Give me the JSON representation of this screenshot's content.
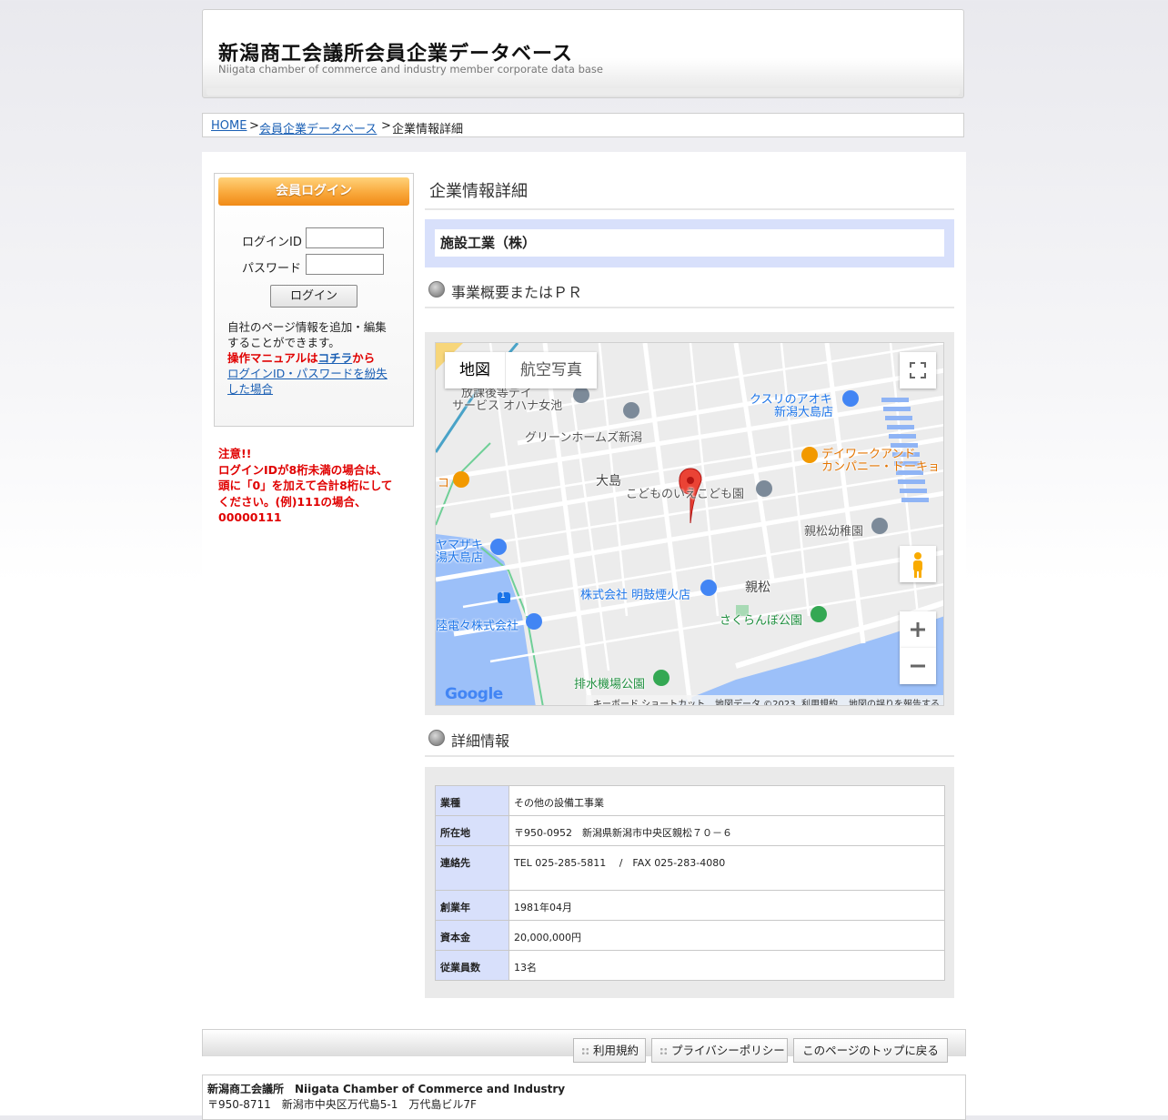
{
  "header": {
    "title": "新潟商工会議所会員企業データベース",
    "subtitle": "Niigata chamber of commerce and industry member corporate data base"
  },
  "breadcrumb": {
    "home": "HOME",
    "sep1": ">",
    "db": "会員企業データベース",
    "sep2": ">",
    "current": "企業情報詳細"
  },
  "sidebar": {
    "login_title": "会員ログイン",
    "login_id_label": "ログインID",
    "password_label": "パスワード",
    "login_id_value": "",
    "password_value": "",
    "login_button": "ログイン",
    "info_line1": "自社のページ情報を追加・編集",
    "info_line2": "することができます。",
    "manual_prefix": "操作マニュアルは",
    "manual_link": "コチラ",
    "manual_suffix": "から",
    "lost_link_line1": "ログインID・パスワードを紛失",
    "lost_link_line2": "した場合",
    "notice_title": "注意!!",
    "notice_line1": "ログインIDが8桁未満の場合は、",
    "notice_line2": "頭に「0」を加えて合計8桁にして",
    "notice_line3": "ください。(例)111の場合、",
    "notice_line4": "00000111"
  },
  "main": {
    "page_title": "企業情報詳細",
    "company_name": "施設工業（株）",
    "section_pr": "事業概要またはＰＲ",
    "section_detail": "詳細情報"
  },
  "map": {
    "type_map": "地図",
    "type_satellite": "航空写真",
    "labels": {
      "houkago1": "放課後等デイ",
      "houkago2": "サービス オハナ女池",
      "green_homes": "グリーンホームズ新潟",
      "kusuri1": "クスリのアオキ",
      "kusuri2": "新潟大島店",
      "dayworks1": "デイワークアンド",
      "dayworks2": "カンパニー・ドーキョ",
      "oshima": "大島",
      "kodomo": "こどものいえこども園",
      "shinmatsu_kinder": "親松幼稚園",
      "yamazaki1": "ヤマザキ",
      "yamazaki2": "湯大島店",
      "meikoen": "株式会社 明鼓煙火店",
      "shinmatsu": "親松",
      "hokuriku": "陸電々株式会社",
      "sakuranbo": "さくらんぼ公園",
      "haisui": "排水機場公園",
      "edge_left": "コ",
      "route": "1"
    },
    "footer": {
      "keyboard": "キーボード ショートカット",
      "data": "地図データ ©2023",
      "terms": "利用規約",
      "report": "地図の誤りを報告する"
    },
    "logo": "Google",
    "icons": [
      "fullscreen-icon",
      "pegman-icon",
      "zoom-in-icon",
      "zoom-out-icon",
      "map-marker-icon"
    ],
    "colors": {
      "marker": "#ea4335",
      "water": "#9cc0f9",
      "road": "#ffffff",
      "land": "#ececec",
      "park": "#34a853",
      "shop": "#4285f4",
      "food": "#f29900"
    }
  },
  "details": {
    "rows": [
      {
        "label": "業種",
        "value": "その他の設備工事業"
      },
      {
        "label": "所在地",
        "value": "〒950-0952　新潟県新潟市中央区親松７０－６"
      },
      {
        "label": "連絡先",
        "value": "TEL 025-285-5811　 /　FAX 025-283-4080"
      },
      {
        "label": "創業年",
        "value": "1981年04月"
      },
      {
        "label": "資本金",
        "value": "20,000,000円"
      },
      {
        "label": "従業員数",
        "value": "13名"
      }
    ]
  },
  "footer": {
    "terms": "利用規約",
    "privacy": "プライバシーポリシー",
    "back_to_top": "このページのトップに戻る",
    "org": "新潟商工会議所　Niigata Chamber of Commerce and Industry",
    "address": "〒950-8711　新潟市中央区万代島5-1　万代島ビル7F"
  }
}
